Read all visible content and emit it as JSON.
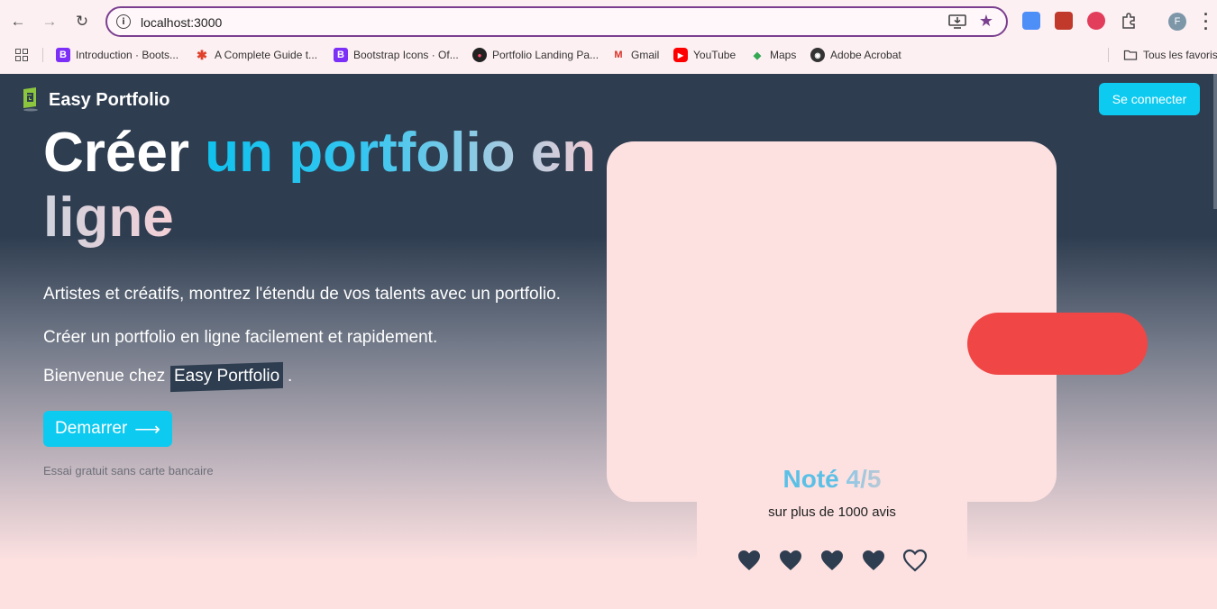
{
  "browser": {
    "url": "localhost:3000",
    "bookmarks": [
      {
        "label": "Introduction · Boots...",
        "icon": "bootstrap-icon",
        "color": "#7b2ff7",
        "glyph": "B"
      },
      {
        "label": "A Complete Guide t...",
        "icon": "asterisk-icon",
        "color": "#e0402a",
        "glyph": "✱"
      },
      {
        "label": "Bootstrap Icons · Of...",
        "icon": "bootstrap-icon",
        "color": "#7b2ff7",
        "glyph": "B"
      },
      {
        "label": "Portfolio Landing Pa...",
        "icon": "portfolio-icon",
        "color": "#222222",
        "glyph": "●"
      },
      {
        "label": "Gmail",
        "icon": "gmail-icon",
        "color": "#ffffff",
        "glyph": "M"
      },
      {
        "label": "YouTube",
        "icon": "youtube-icon",
        "color": "#ff0000",
        "glyph": "▶"
      },
      {
        "label": "Maps",
        "icon": "maps-icon",
        "color": "#34a853",
        "glyph": "◆"
      },
      {
        "label": "Adobe Acrobat",
        "icon": "globe-icon",
        "color": "#333333",
        "glyph": "◉"
      }
    ],
    "all_bookmarks": "Tous les favoris",
    "profile_initial": "F"
  },
  "header": {
    "brand": "Easy Portfolio",
    "connect": "Se connecter"
  },
  "hero": {
    "title_word1": "Créer",
    "title_word2": "un portfolio en",
    "title_word3": "ligne",
    "para1": "Artistes et créatifs, montrez l'étendu de vos talents avec un portfolio.",
    "para2": "Créer un portfolio en ligne facilement et rapidement.",
    "para3_prefix": "Bienvenue chez",
    "para3_highlight": "Easy Portfolio",
    "para3_suffix": ".",
    "start_button": "Demarrer",
    "trial_note": "Essai gratuit sans carte bancaire"
  },
  "rating": {
    "title_prefix": "Noté",
    "title_score": "4/5",
    "subtitle": "sur plus de 1000 avis",
    "filled_hearts": 4,
    "total_hearts": 5
  },
  "colors": {
    "accent": "#0dcaf0",
    "dark": "#2e3d50",
    "card": "#fde1e1",
    "pill": "#f04646"
  }
}
